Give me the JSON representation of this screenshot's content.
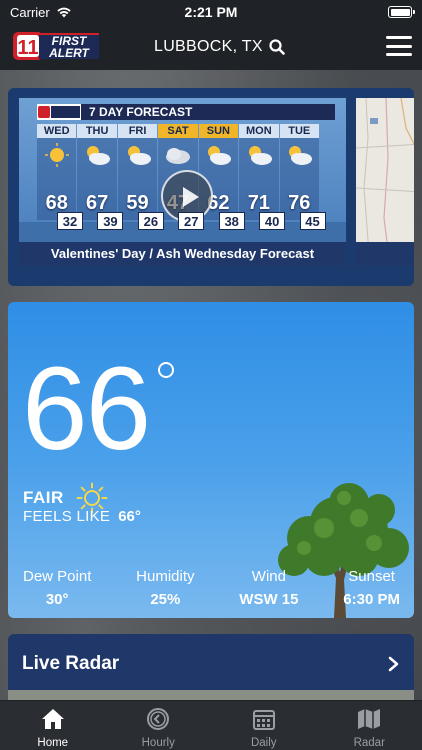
{
  "status_bar": {
    "carrier": "Carrier",
    "time": "2:21 PM"
  },
  "header": {
    "logo_text_top": "FIRST",
    "logo_text_bottom": "ALERT",
    "logo_number": "11",
    "location": "LUBBOCK, TX"
  },
  "video": {
    "banner_title": "7 DAY FORECAST",
    "caption": "Valentines' Day / Ash Wednesday Forecast",
    "days": [
      {
        "name": "WED",
        "high": "68",
        "low": "32",
        "icon": "sunny-icon",
        "weekend": false
      },
      {
        "name": "THU",
        "high": "67",
        "low": "39",
        "icon": "partly-cloudy-icon",
        "weekend": false
      },
      {
        "name": "FRI",
        "high": "59",
        "low": "26",
        "icon": "partly-cloudy-icon",
        "weekend": false
      },
      {
        "name": "SAT",
        "high": "47",
        "low": "27",
        "icon": "cloudy-icon",
        "weekend": true
      },
      {
        "name": "SUN",
        "high": "62",
        "low": "38",
        "icon": "partly-cloudy-icon",
        "weekend": true
      },
      {
        "name": "MON",
        "high": "71",
        "low": "40",
        "icon": "partly-cloudy-icon",
        "weekend": false
      },
      {
        "name": "TUE",
        "high": "76",
        "low": "45",
        "icon": "partly-cloudy-icon",
        "weekend": false
      }
    ]
  },
  "current": {
    "temperature": "66",
    "condition": "FAIR",
    "feels_like_label": "FEELS LIKE",
    "feels_like_value": "66°",
    "stats": [
      {
        "label": "Dew Point",
        "value": "30°"
      },
      {
        "label": "Humidity",
        "value": "25%"
      },
      {
        "label": "Wind",
        "value": "WSW 15"
      },
      {
        "label": "Sunset",
        "value": "6:30 PM"
      }
    ]
  },
  "radar": {
    "title": "Live Radar"
  },
  "tabs": [
    {
      "label": "Home",
      "icon": "home-icon",
      "active": true
    },
    {
      "label": "Hourly",
      "icon": "clock-icon",
      "active": false
    },
    {
      "label": "Daily",
      "icon": "calendar-icon",
      "active": false
    },
    {
      "label": "Radar",
      "icon": "map-icon",
      "active": false
    }
  ],
  "colors": {
    "accent_blue": "#2f8ee5",
    "navy": "#20376a",
    "alert_red": "#d0202a",
    "weekend_gold": "#f1b52a"
  }
}
